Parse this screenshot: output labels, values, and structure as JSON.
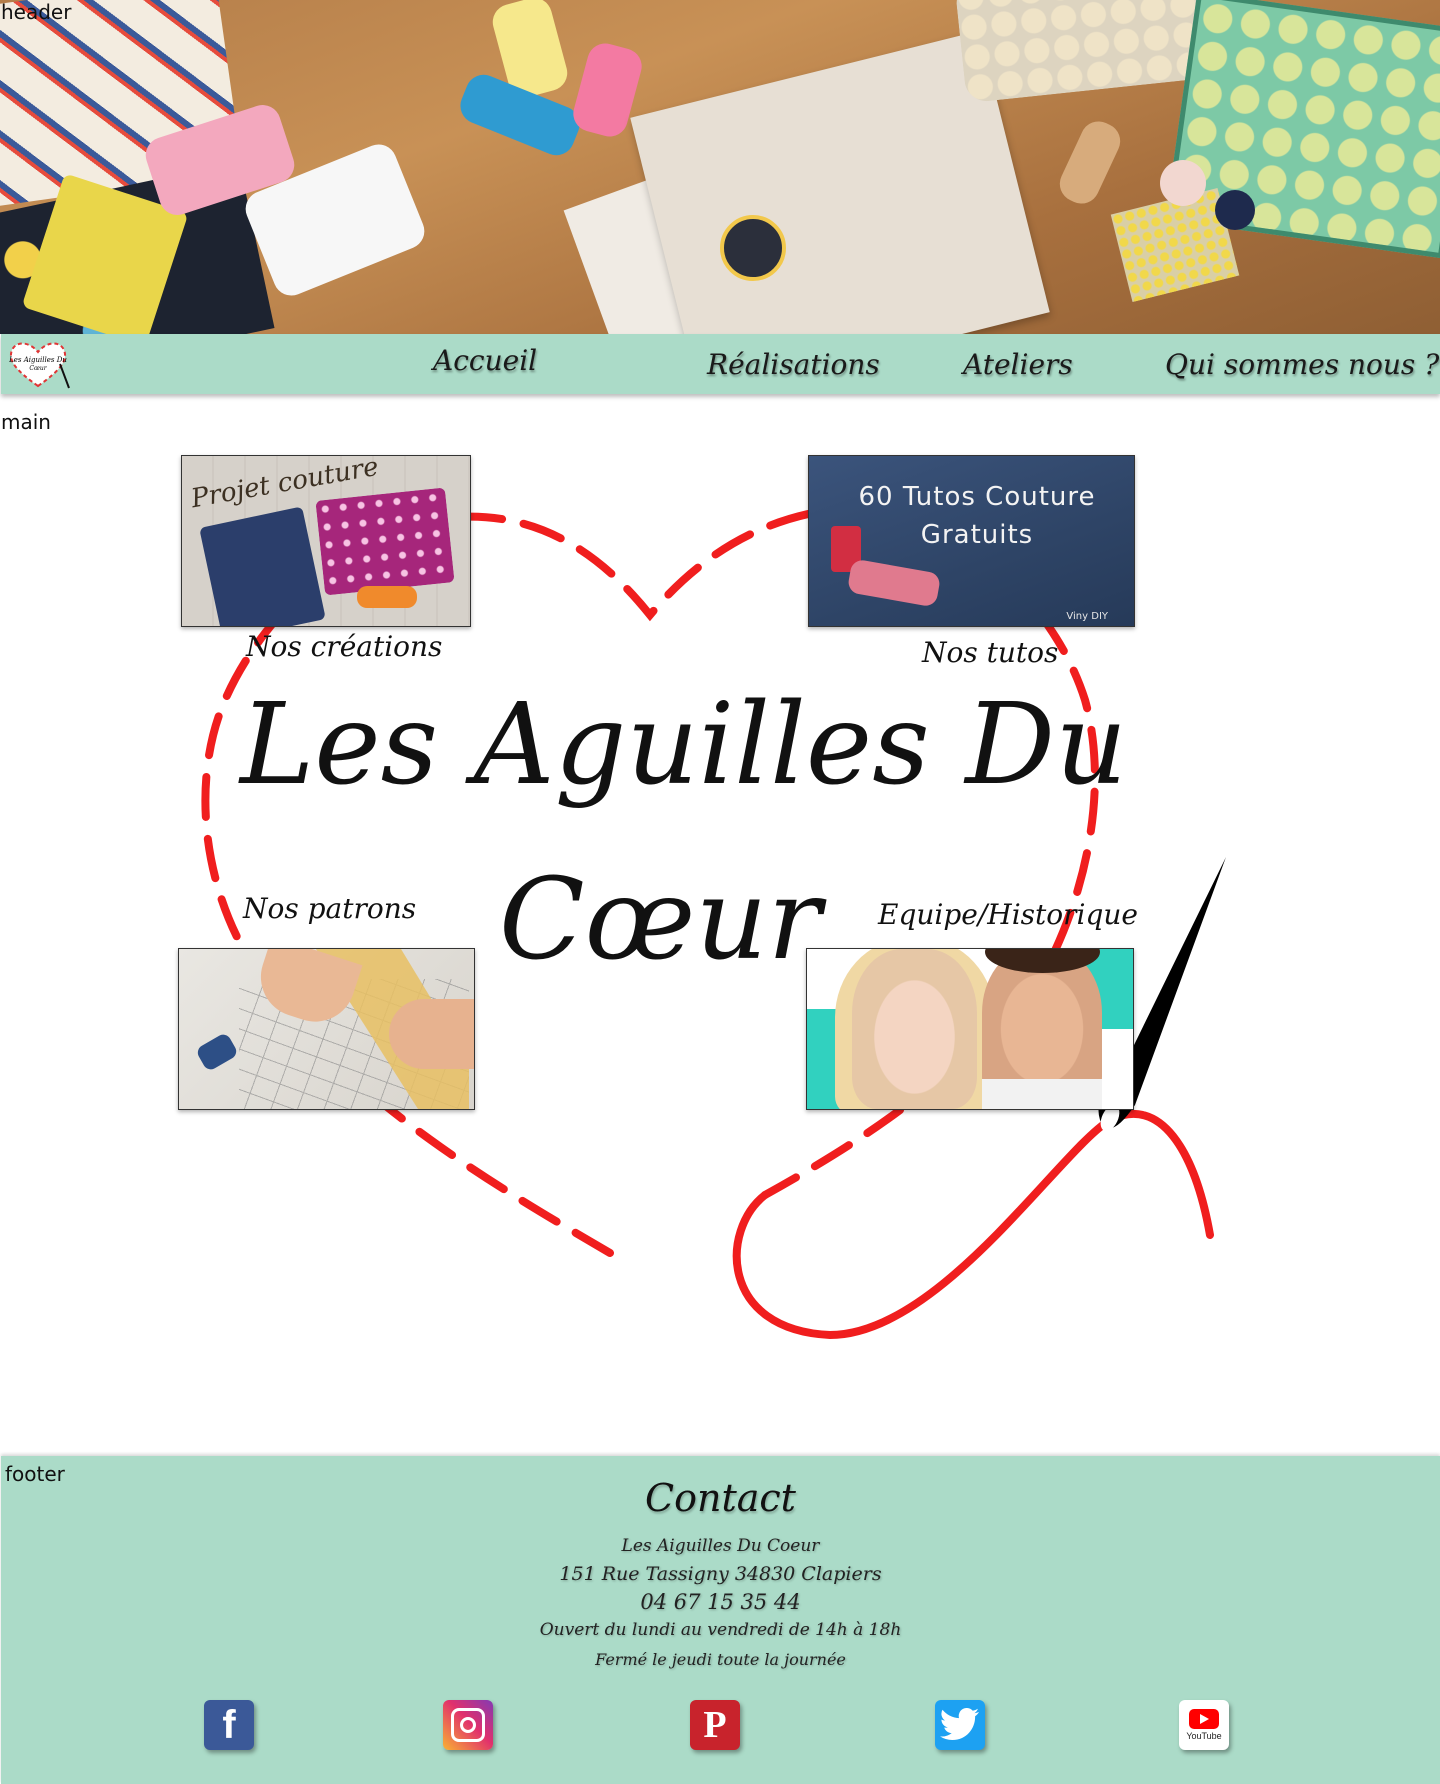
{
  "header": {
    "label": "header"
  },
  "nav": {
    "logo_text": "Les Aiguilles Du Cœur",
    "items": [
      {
        "label": "Accueil"
      },
      {
        "label": "Réalisations"
      },
      {
        "label": "Ateliers"
      },
      {
        "label": "Qui sommes nous ?"
      }
    ]
  },
  "main": {
    "label": "main",
    "title_line1": "Les Aguilles Du",
    "title_line2": "Cœur",
    "tiles": [
      {
        "caption": "Nos créations",
        "image_text": "Projet couture"
      },
      {
        "caption": "Nos tutos",
        "image_text_line1": "60 Tutos Couture",
        "image_text_line2": "Gratuits",
        "image_watermark": "Viny DIY"
      },
      {
        "caption": "Nos patrons"
      },
      {
        "caption": "Equipe/Historique"
      }
    ]
  },
  "footer": {
    "label": "footer",
    "contact_title": "Contact",
    "name": "Les Aiguilles Du Coeur",
    "address": "151 Rue Tassigny  34830 Clapiers",
    "phone": "04 67 15 35 44",
    "hours": "Ouvert du lundi au vendredi de 14h à 18h",
    "closed": "Fermé le jeudi toute la journée",
    "social": [
      {
        "icon": "facebook-icon",
        "color": "#3b5998"
      },
      {
        "icon": "instagram-icon",
        "color": "#d6249f"
      },
      {
        "icon": "pinterest-icon",
        "color": "#c8232c"
      },
      {
        "icon": "twitter-icon",
        "color": "#1da1f2"
      },
      {
        "icon": "youtube-icon",
        "color": "#ff0000",
        "label": "YouTube"
      }
    ]
  },
  "colors": {
    "mint": "#abdbc8",
    "heart_red": "#f01e1e"
  }
}
